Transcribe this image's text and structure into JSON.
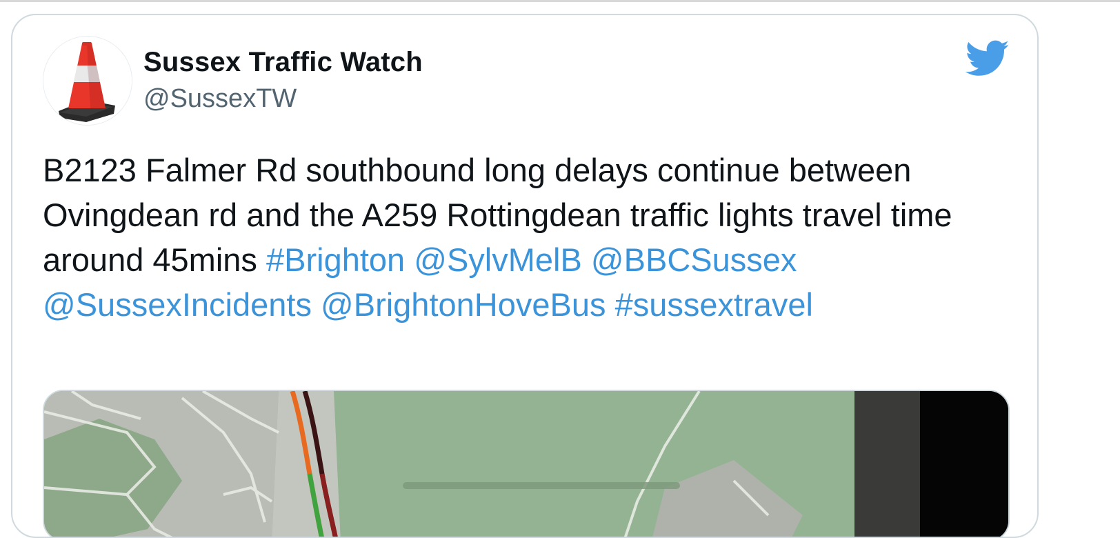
{
  "tweet": {
    "display_name": "Sussex Traffic Watch",
    "handle": "@SussexTW",
    "text_plain": "B2123 Falmer Rd southbound long delays continue between Ovingdean rd and the A259 Rottingdean traffic lights travel time around 45mins",
    "links": [
      "#Brighton",
      "@SylvMelB",
      "@BBCSussex",
      "@SussexIncidents",
      "@BrightonHoveBus",
      "#sussextravel"
    ]
  },
  "icons": {
    "brand": "twitter-bird-icon",
    "avatar": "traffic-cone-icon"
  },
  "colors": {
    "link": "#3b94d9",
    "twitter_blue": "#4a9ee8",
    "text": "#0f1419",
    "secondary": "#536471",
    "border": "#cfd9de",
    "map_green": "#8fb08d"
  }
}
